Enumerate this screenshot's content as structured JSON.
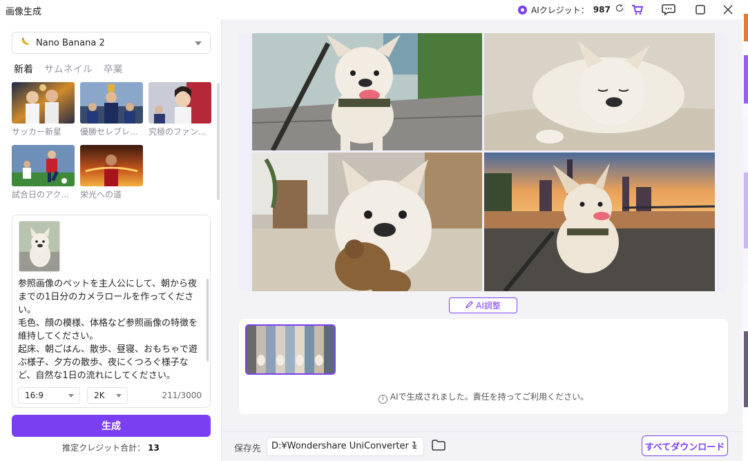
{
  "window": {
    "title": "画像生成",
    "credit_label": "AIクレジット：",
    "credit_value": "987"
  },
  "left": {
    "model": "Nano Banana 2",
    "tabs": [
      "新着",
      "サムネイル",
      "卒業"
    ],
    "templates": [
      {
        "label": "サッカー新星"
      },
      {
        "label": "優勝セレブレー..."
      },
      {
        "label": "究極のファン..."
      },
      {
        "label": "試合日のアク..."
      },
      {
        "label": "栄光への道"
      }
    ],
    "prompt": "参照画像のペットを主人公にして、朝から夜までの1日分のカメラロールを作ってください。\n毛色、顔の模様、体格など参照画像の特徴を維持してください。\n起床、朝ごはん、散歩、昼寝、おもちゃで遊ぶ様子、夕方の散歩、夜にくつろぐ様子など、自然な1日の流れにしてください。\n飼い主がスマホで何気なく撮ったような距離感と",
    "aspect": "16:9",
    "resolution": "2K",
    "char_count": "211/3000",
    "generate_label": "生成",
    "credit_total_label": "推定クレジット合計：",
    "credit_total_value": "13"
  },
  "main": {
    "ai_adjust_label": "AI調整",
    "ai_note": "AIで生成されました。責任を持ってご利用ください。"
  },
  "bottom": {
    "save_label": "保存先",
    "save_path": "D:¥Wondershare UniConverter 1",
    "download_all_label": "すべてダウンロード"
  },
  "colors": {
    "accent": "#7b3ff2"
  }
}
